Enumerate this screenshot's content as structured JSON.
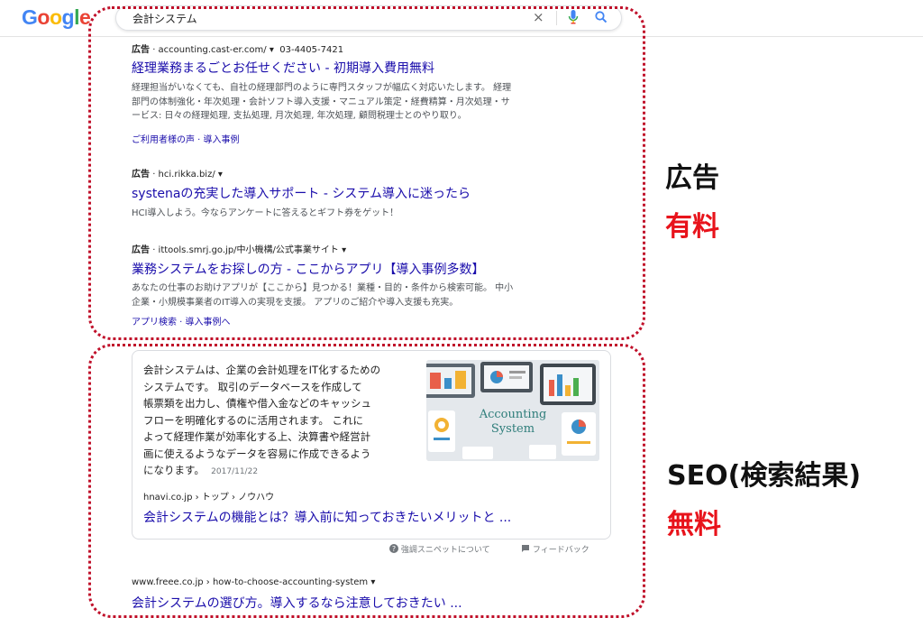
{
  "header": {
    "logo_letters": [
      "G",
      "o",
      "o",
      "g",
      "l",
      "e"
    ],
    "search_query": "会計システム",
    "clear_glyph": "×",
    "icons": [
      "microphone-icon",
      "search-icon"
    ]
  },
  "ads": [
    {
      "label": "広告",
      "url": "· accounting.cast-er.com/",
      "dropdown": "▾",
      "phone": "03-4405-7421",
      "title": "経理業務まるごとお任せください - 初期導入費用無料",
      "desc_lines": [
        "経理担当がいなくても、自社の経理部門のように専門スタッフが幅広く対応いたします。 経理",
        "部門の体制強化・年次処理・会計ソフト導入支援・マニュアル策定・経費精算・月次処理・サ",
        "ービス: 日々の経理処理, 支払処理, 月次処理, 年次処理, 顧問税理士とのやり取り。"
      ],
      "sitelinks": "ご利用者様の声 · 導入事例"
    },
    {
      "label": "広告",
      "url": "· hci.rikka.biz/",
      "dropdown": "▾",
      "title": "systenaの充実した導入サポート - システム導入に迷ったら",
      "desc_lines": [
        "HCI導入しよう。今ならアンケートに答えるとギフト券をゲット！"
      ]
    },
    {
      "label": "広告",
      "url": "· ittools.smrj.go.jp/中小機構/公式事業サイト",
      "dropdown": "▾",
      "title": "業務システムをお探しの方 - ここからアプリ【導入事例多数】",
      "desc_lines": [
        "あなたの仕事のお助けアプリが【ここから】見つかる！業種・目的・条件から検索可能。 中小",
        "企業・小規模事業者のIT導入の実現を支援。 アプリのご紹介や導入支援も充実。"
      ],
      "sitelinks": "アプリ検索 · 導入事例へ"
    }
  ],
  "snippet": {
    "text_lines": [
      "会計システムは、企業の会計処理をIT化するための",
      "システムです。 取引のデータベースを作成して",
      "帳票類を出力し、債権や借入金などのキャッシュ",
      "フローを明確化するのに活用されます。 これに",
      "よって経理作業が効率化する上、決算書や経営計",
      "画に使えるようなデータを容易に作成できるよう",
      "になります。"
    ],
    "date": "2017/11/22",
    "image_text": [
      "Accounting",
      "System"
    ],
    "site": "hnavi.co.jp › トップ › ノウハウ",
    "title": "会計システムの機能とは？導入前に知っておきたいメリットと ...",
    "about_label": "強調スニペットについて",
    "feedback_label": "フィードバック"
  },
  "organic": {
    "site": "www.freee.co.jp › how-to-choose-accounting-system",
    "dropdown": "▾",
    "title": "会計システムの選び方。導入するなら注意しておきたい ..."
  },
  "labels": {
    "ad_heading": "広告",
    "ad_price": "有料",
    "seo_heading": "SEO(検索結果)",
    "seo_price": "無料"
  },
  "colors": {
    "link": "#1a0dab",
    "dotted_border": "#c0102a",
    "price_red": "#e8131b"
  }
}
